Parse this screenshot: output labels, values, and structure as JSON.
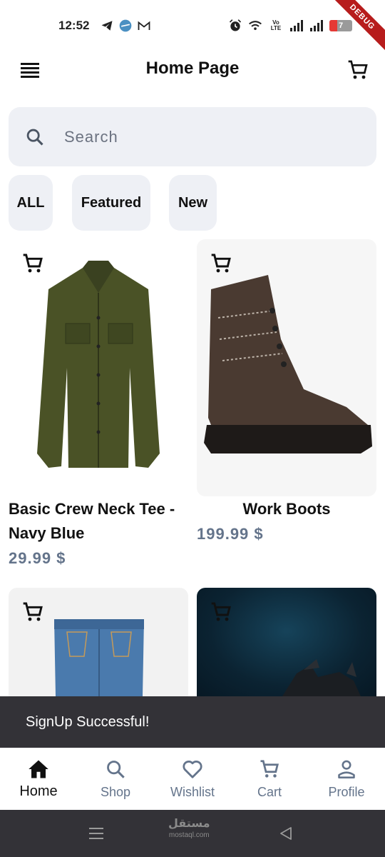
{
  "status_bar": {
    "time": "12:52",
    "battery": "7",
    "network": "Vo LTE"
  },
  "debug_banner": "DEBUG",
  "app_bar": {
    "title": "Home Page"
  },
  "search": {
    "placeholder": "Search"
  },
  "chips": [
    {
      "label": "ALL"
    },
    {
      "label": "Featured"
    },
    {
      "label": "New"
    }
  ],
  "products": [
    {
      "title_line1": "Basic Crew Neck Tee -",
      "title_line2": "Navy Blue",
      "price": "29.99 $",
      "image": "olive-jacket"
    },
    {
      "title_line1": "Work Boots",
      "title_line2": "",
      "price": "199.99 $",
      "image": "brown-boot"
    },
    {
      "title_line1": "",
      "title_line2": "",
      "price": "",
      "image": "blue-jeans"
    },
    {
      "title_line1": "",
      "title_line2": "",
      "price": "",
      "image": "dark-blue-product"
    }
  ],
  "snackbar": {
    "message": "SignUp Successful!"
  },
  "bottom_nav": [
    {
      "label": "Home",
      "icon": "home-icon",
      "active": true
    },
    {
      "label": "Shop",
      "icon": "search-icon",
      "active": false
    },
    {
      "label": "Wishlist",
      "icon": "heart-icon",
      "active": false
    },
    {
      "label": "Cart",
      "icon": "cart-icon",
      "active": false
    },
    {
      "label": "Profile",
      "icon": "person-icon",
      "active": false
    }
  ],
  "watermark": {
    "line1": "مستقل",
    "line2": "mostaql.com"
  },
  "colors": {
    "chip_bg": "#eef0f5",
    "price": "#64748b",
    "snackbar_bg": "#333237",
    "active_nav": "#111111"
  }
}
